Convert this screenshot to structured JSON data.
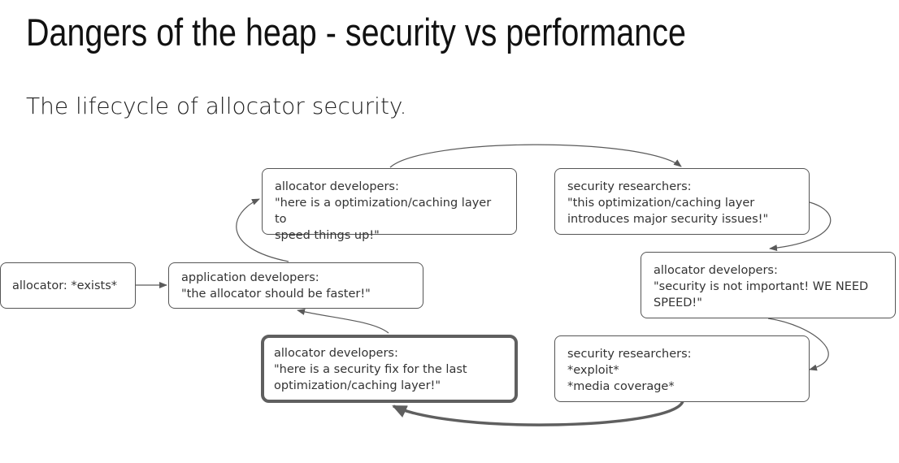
{
  "slide": {
    "title": "Dangers of the heap - security vs performance",
    "subtitle": "The lifecycle of allocator security."
  },
  "diagram": {
    "nodes": {
      "allocator_exists": {
        "lines": [
          "allocator: *exists*"
        ]
      },
      "app_devs_request": {
        "lines": [
          "application developers:",
          "\"the allocator should be faster!\""
        ]
      },
      "alloc_devs_optimize": {
        "lines": [
          "allocator developers:",
          "\"here is a optimization/caching layer to",
          "speed things up!\""
        ]
      },
      "researchers_warn": {
        "lines": [
          "security researchers:",
          "\"this optimization/caching layer",
          "introduces major security issues!\""
        ]
      },
      "alloc_devs_dismiss": {
        "lines": [
          "allocator developers:",
          "\"security is not important! WE NEED",
          "SPEED!\""
        ]
      },
      "researchers_exploit": {
        "lines": [
          "security researchers:",
          "*exploit*",
          "*media coverage*"
        ]
      },
      "alloc_devs_fix": {
        "lines": [
          "allocator developers:",
          "\"here is a security fix for the last",
          "optimization/caching layer!\""
        ]
      }
    },
    "colors": {
      "border": "#555555",
      "arrow": "#5a5a5a",
      "highlight_border": "#5f5f5f"
    }
  }
}
